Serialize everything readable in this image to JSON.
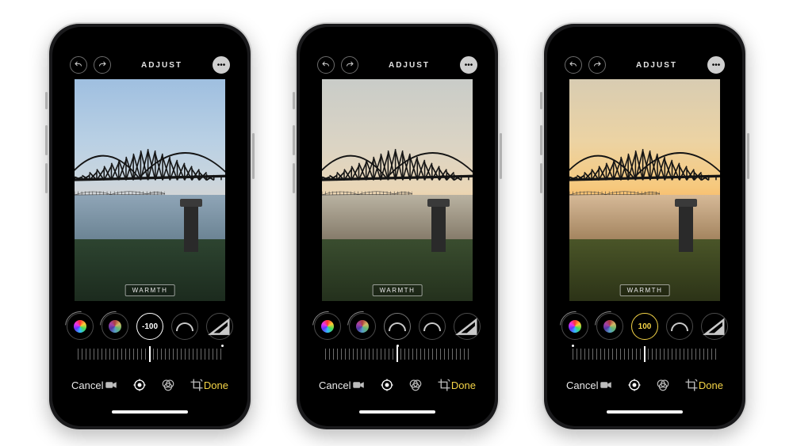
{
  "header": {
    "title": "ADJUST",
    "undo_icon": "undo-icon",
    "redo_icon": "redo-icon",
    "more_icon": "ellipsis-icon"
  },
  "control": {
    "label": "WARMTH"
  },
  "dials": {
    "items": [
      {
        "name": "hue-a",
        "kind": "hue"
      },
      {
        "name": "hue-b",
        "kind": "hue-dim"
      },
      {
        "name": "warmth",
        "kind": "value"
      },
      {
        "name": "tint",
        "kind": "halfring"
      },
      {
        "name": "sharpness",
        "kind": "triangle"
      }
    ]
  },
  "toolbar": {
    "cancel": "Cancel",
    "done": "Done",
    "tools": [
      {
        "name": "video-icon"
      },
      {
        "name": "adjust-icon"
      },
      {
        "name": "filters-icon"
      },
      {
        "name": "crop-icon"
      }
    ]
  },
  "phones": [
    {
      "id": "cold",
      "warmth_value": "-100",
      "warmth_display": "-100",
      "slider_percent": 50,
      "dot_percent": 100,
      "dial_style": "white"
    },
    {
      "id": "mid",
      "warmth_value": "0",
      "warmth_display": "",
      "slider_percent": 50,
      "dot_percent": 50,
      "dial_style": "plain"
    },
    {
      "id": "warm",
      "warmth_value": "100",
      "warmth_display": "100",
      "slider_percent": 50,
      "dot_percent": 0,
      "dial_style": "yellow"
    }
  ]
}
